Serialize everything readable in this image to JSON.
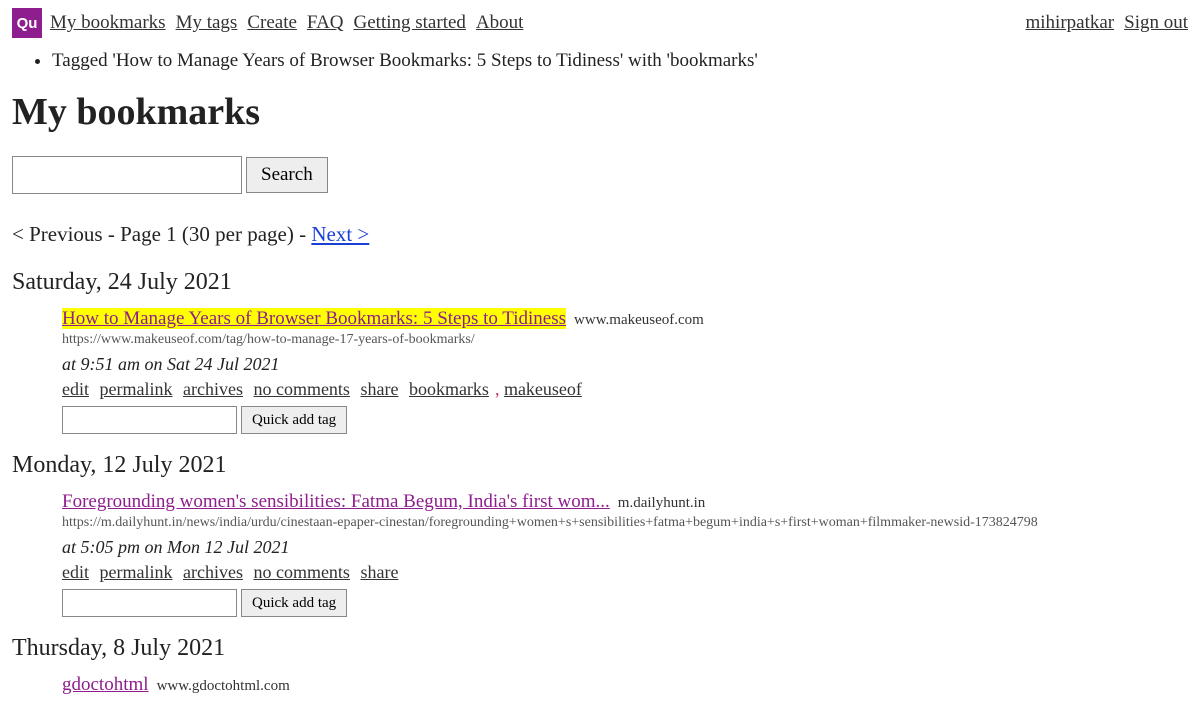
{
  "logo_text": "Qu",
  "nav": {
    "my_bookmarks": "My bookmarks",
    "my_tags": "My tags",
    "create": "Create",
    "faq": "FAQ",
    "getting_started": "Getting started",
    "about": "About"
  },
  "user": {
    "username": "mihirpatkar",
    "signout": "Sign out"
  },
  "status_message": "Tagged 'How to Manage Years of Browser Bookmarks: 5 Steps to Tidiness' with 'bookmarks'",
  "page_title": "My bookmarks",
  "search_button": "Search",
  "pager": {
    "prev": "< Previous",
    "sep1": " - ",
    "page_info": "Page 1 (30 per page)",
    "sep2": " - ",
    "next": "Next >"
  },
  "quick_add_label": "Quick add tag",
  "actions": {
    "edit": "edit",
    "permalink": "permalink",
    "archives": "archives",
    "no_comments": "no comments",
    "share": "share"
  },
  "dates": {
    "d1": "Saturday, 24 July 2021",
    "d2": "Monday, 12 July 2021",
    "d3": "Thursday, 8 July 2021"
  },
  "bookmarks": {
    "b1": {
      "title": "How to Manage Years of Browser Bookmarks: 5 Steps to Tidiness",
      "domain": "www.makeuseof.com",
      "url": "https://www.makeuseof.com/tag/how-to-manage-17-years-of-bookmarks/",
      "time": "at 9:51 am on Sat 24 Jul 2021",
      "tag1": "bookmarks",
      "tag_sep": ", ",
      "tag2": "makeuseof"
    },
    "b2": {
      "title": "Foregrounding women's sensibilities: Fatma Begum, India's first wom...",
      "domain": "m.dailyhunt.in",
      "url": "https://m.dailyhunt.in/news/india/urdu/cinestaan-epaper-cinestan/foregrounding+women+s+sensibilities+fatma+begum+india+s+first+woman+filmmaker-newsid-173824798",
      "time": "at 5:05 pm on Mon 12 Jul 2021"
    },
    "b3": {
      "title": "gdoctohtml",
      "domain": "www.gdoctohtml.com"
    }
  }
}
